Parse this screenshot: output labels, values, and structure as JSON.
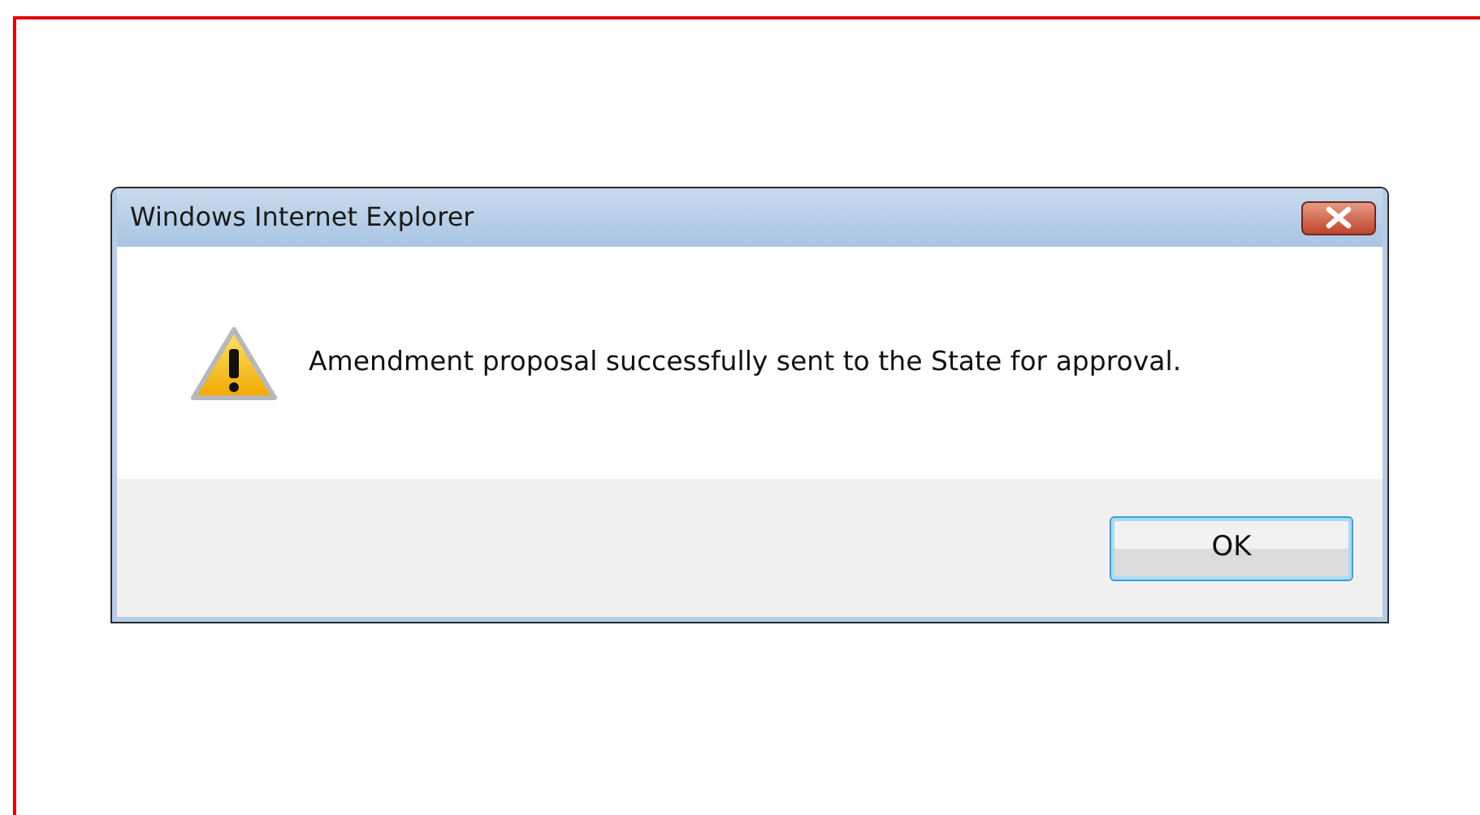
{
  "window": {
    "title": "Windows Internet Explorer"
  },
  "message": "Amendment proposal successfully sent to the State for approval.",
  "buttons": [
    {
      "label": "OK",
      "selected": true
    }
  ]
}
